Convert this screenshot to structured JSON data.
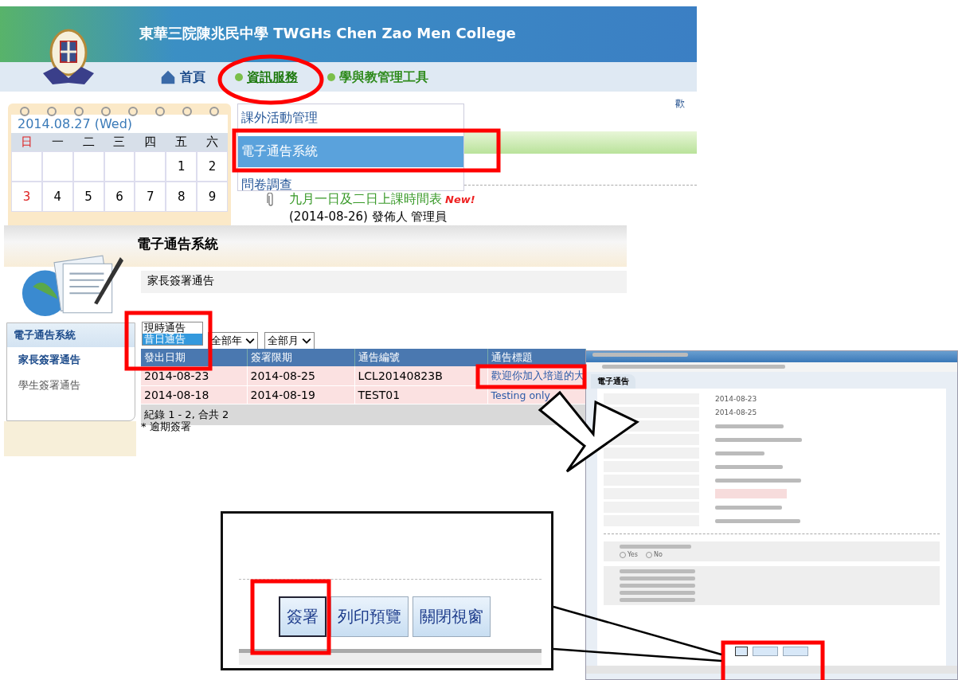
{
  "portal": {
    "school_title": "東華三院陳兆民中學 TWGHs Chen Zao Men College",
    "nav": [
      {
        "label": "首頁",
        "kind": "home"
      },
      {
        "label": "資訊服務",
        "kind": "menu",
        "expanded": true
      },
      {
        "label": "學與教管理工具",
        "kind": "menu",
        "expanded": false
      }
    ],
    "welcome": "歡",
    "dropdown_menu": [
      {
        "label": "課外活動管理",
        "selected": false
      },
      {
        "label": "電子通告系統",
        "selected": true
      },
      {
        "label": "問卷調查",
        "selected": false
      }
    ],
    "calendar": {
      "date": "2014.08.27 (Wed)",
      "weekdays": [
        {
          "label": "日",
          "holiday": true
        },
        {
          "label": "一",
          "holiday": false
        },
        {
          "label": "二",
          "holiday": false
        },
        {
          "label": "三",
          "holiday": false
        },
        {
          "label": "四",
          "holiday": false
        },
        {
          "label": "五",
          "holiday": false
        },
        {
          "label": "六",
          "holiday": false
        }
      ],
      "weeks": [
        [
          "1",
          "2"
        ],
        [
          "3",
          "4",
          "5",
          "6",
          "7",
          "8",
          "9"
        ]
      ]
    },
    "news": {
      "title": "九月一日及二日上課時間表",
      "badge": "New!",
      "meta": "(2014-08-26) 發佈人 管理員"
    }
  },
  "notice_system": {
    "header": "電子通告系統",
    "sidebar": {
      "section": "電子通告系統",
      "items": [
        {
          "label": "家長簽署通告",
          "selected": true
        },
        {
          "label": "學生簽署通告",
          "selected": false
        }
      ]
    },
    "page_title": "家長簽署通告",
    "notice_type_options": [
      {
        "label": "現時通告",
        "selected": false
      },
      {
        "label": "昔日通告",
        "selected": true
      }
    ],
    "year_select": "全部年",
    "month_select": "全部月",
    "table": {
      "columns": [
        "發出日期",
        "簽署限期",
        "通告編號",
        "通告標題"
      ],
      "rows": [
        {
          "cells": [
            "2014-08-23",
            "2014-08-25",
            "LCL20140823B",
            "歡迎你加入培道的大"
          ],
          "overdue": true
        },
        {
          "cells": [
            "2014-08-18",
            "2014-08-19",
            "TEST01",
            "Testing only"
          ],
          "overdue": true
        }
      ],
      "footer": "紀錄 1 - 2, 合共 2"
    },
    "legend": "* 逾期簽署"
  },
  "popup_window": {
    "tab": "電子通告",
    "field_rows": [
      {
        "kind": "text",
        "value": "2014-08-23"
      },
      {
        "kind": "text",
        "value": "2014-08-25"
      },
      {
        "kind": "blurred"
      },
      {
        "kind": "blurred"
      },
      {
        "kind": "blurred"
      },
      {
        "kind": "blurred"
      },
      {
        "kind": "blurred"
      },
      {
        "kind": "input"
      },
      {
        "kind": "blurred"
      },
      {
        "kind": "blurred"
      }
    ],
    "poll_options": [
      {
        "label": "Yes"
      },
      {
        "label": "No"
      }
    ]
  },
  "zoom_inset": {
    "buttons": [
      {
        "label": "簽署",
        "selected": true
      },
      {
        "label": "列印預覽",
        "selected": false
      },
      {
        "label": "關閉視窗",
        "selected": false
      }
    ]
  }
}
